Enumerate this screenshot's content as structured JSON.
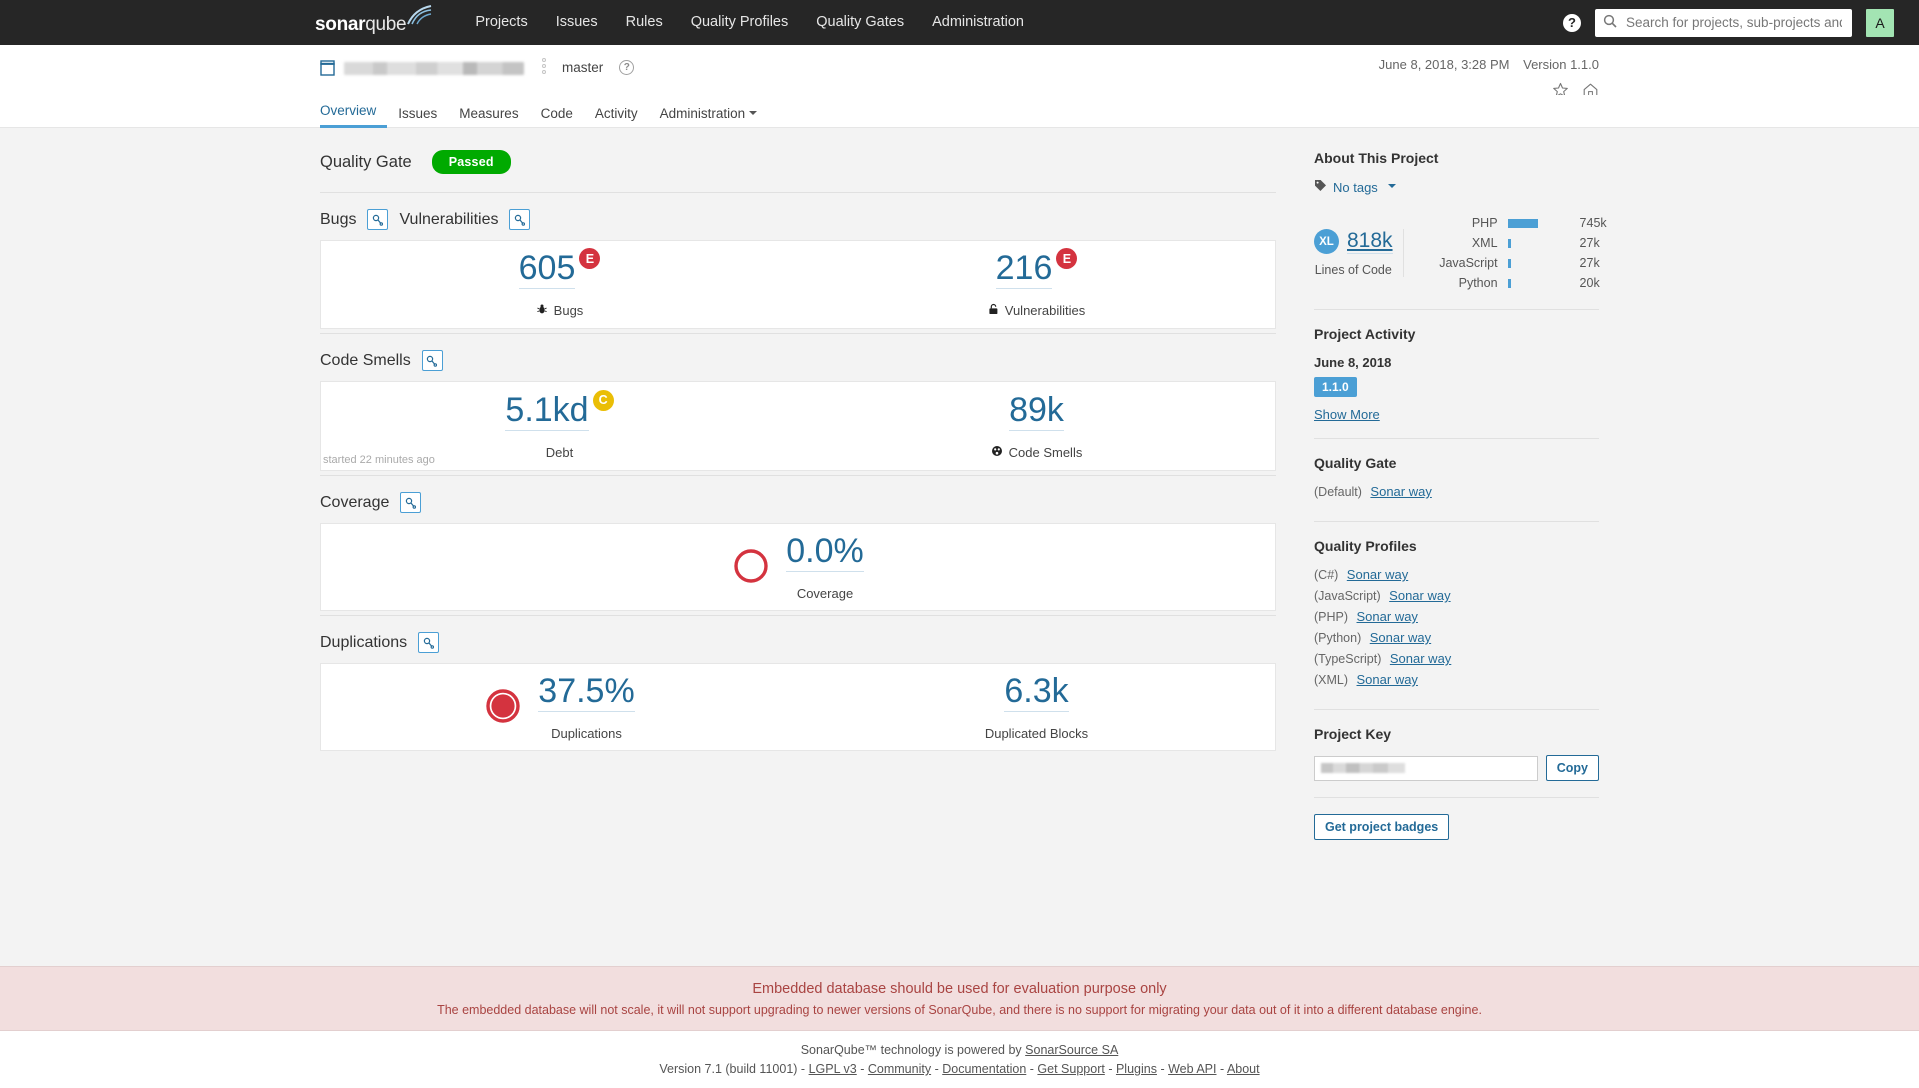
{
  "navbar": {
    "logo_bold": "sonar",
    "logo_light": "qube",
    "menu": [
      {
        "label": "Projects"
      },
      {
        "label": "Issues"
      },
      {
        "label": "Rules"
      },
      {
        "label": "Quality Profiles"
      },
      {
        "label": "Quality Gates"
      },
      {
        "label": "Administration"
      }
    ],
    "help_label": "?",
    "search_placeholder": "Search for projects, sub-projects and files...",
    "search_value": "",
    "avatar_initial": "A"
  },
  "context": {
    "project_name": "",
    "branch": "master",
    "analysis_date": "June 8, 2018, 3:28 PM",
    "version": "Version 1.1.0"
  },
  "tabs": [
    {
      "label": "Overview",
      "active": true
    },
    {
      "label": "Issues",
      "active": false
    },
    {
      "label": "Measures",
      "active": false
    },
    {
      "label": "Code",
      "active": false
    },
    {
      "label": "Activity",
      "active": false
    },
    {
      "label": "Administration",
      "active": false,
      "has_caret": true
    }
  ],
  "quality_gate": {
    "label": "Quality Gate",
    "status": "Passed",
    "status_color": "#00aa00"
  },
  "sections": [
    {
      "title": "Bugs",
      "second_title": "Vulnerabilities",
      "note": "",
      "left": {
        "value": "605",
        "label": "Bugs",
        "rating": "E",
        "rating_class": "e",
        "icon": "bug-icon"
      },
      "right": {
        "value": "216",
        "label": "Vulnerabilities",
        "rating": "E",
        "rating_class": "e",
        "icon": "vulnerability-icon"
      }
    },
    {
      "title": "Code Smells",
      "note": "started 22 minutes ago",
      "left": {
        "value": "5.1kd",
        "label": "Debt",
        "rating": "C",
        "rating_class": "c",
        "icon": ""
      },
      "right": {
        "value": "89k",
        "label": "Code Smells",
        "rating": "",
        "rating_class": "",
        "icon": "code-smell-icon"
      }
    },
    {
      "title": "Coverage",
      "note": "",
      "center": {
        "value": "0.0%",
        "label": "Coverage",
        "fill_pct": 0,
        "ring_color": "#d4333f"
      }
    },
    {
      "title": "Duplications",
      "note": "",
      "left": {
        "value": "37.5%",
        "label": "Duplications",
        "fill_pct": 100,
        "ring_color": "#d4333f"
      },
      "right": {
        "value": "6.3k",
        "label": "Duplicated Blocks"
      }
    }
  ],
  "sidebar": {
    "about_title": "About This Project",
    "tags_label": "No tags",
    "size_badge": "XL",
    "lines_of_code_value": "818k",
    "lines_of_code_label": "Lines of Code",
    "languages": [
      {
        "name": "PHP",
        "size": "745k",
        "bar_pct": 100
      },
      {
        "name": "XML",
        "size": "27k",
        "bar_pct": 4
      },
      {
        "name": "JavaScript",
        "size": "27k",
        "bar_pct": 4
      },
      {
        "name": "Python",
        "size": "20k",
        "bar_pct": 3
      }
    ],
    "activity_title": "Project Activity",
    "activity_date": "June 8, 2018",
    "activity_version": "1.1.0",
    "show_more": "Show More",
    "quality_gate_title": "Quality Gate",
    "quality_gate_scope": "(Default)",
    "quality_gate_profile": "Sonar way",
    "quality_profiles_title": "Quality Profiles",
    "quality_profiles": [
      {
        "lang": "(C#)",
        "profile": "Sonar way"
      },
      {
        "lang": "(JavaScript)",
        "profile": "Sonar way"
      },
      {
        "lang": "(PHP)",
        "profile": "Sonar way"
      },
      {
        "lang": "(Python)",
        "profile": "Sonar way"
      },
      {
        "lang": "(TypeScript)",
        "profile": "Sonar way"
      },
      {
        "lang": "(XML)",
        "profile": "Sonar way"
      }
    ],
    "project_key_title": "Project Key",
    "project_key_value": "",
    "copy_label": "Copy",
    "badges_label": "Get project badges"
  },
  "alert": {
    "line1": "Embedded database should be used for evaluation purpose only",
    "line2": "The embedded database will not scale, it will not support upgrading to newer versions of SonarQube, and there is no support for migrating your data out of it into a different database engine."
  },
  "footer": {
    "line1_pre": "SonarQube™ technology is powered by ",
    "line1_link": "SonarSource SA",
    "version": "Version 7.1 (build 11001)",
    "links": [
      "LGPL v3",
      "Community",
      "Documentation",
      "Get Support",
      "Plugins",
      "Web API",
      "About"
    ]
  }
}
